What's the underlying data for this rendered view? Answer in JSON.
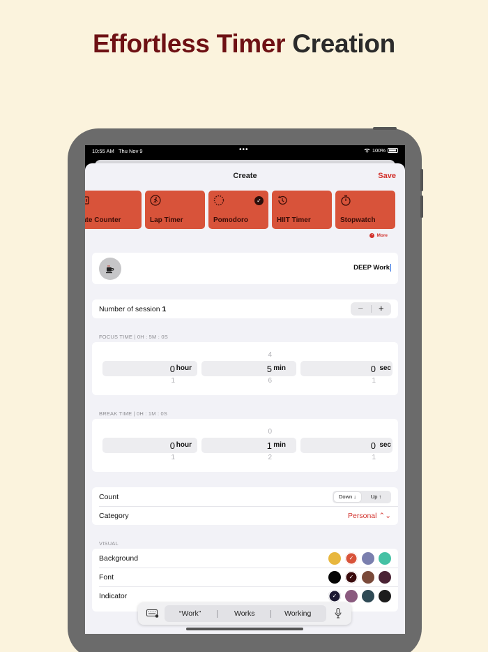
{
  "headline": {
    "part1": "Effortless Timer",
    "part2": "Creation"
  },
  "status_bar": {
    "time": "10:55 AM",
    "date": "Thu Nov 9",
    "battery": "100%"
  },
  "nav": {
    "title": "Create",
    "save_label": "Save"
  },
  "timer_types": [
    {
      "label": "ate Counter",
      "icon": "counter-icon",
      "selected": false
    },
    {
      "label": "Lap Timer",
      "icon": "running-icon",
      "selected": false
    },
    {
      "label": "Pomodoro",
      "icon": "dashed-circle-icon",
      "selected": true
    },
    {
      "label": "HIIT Timer",
      "icon": "history-icon",
      "selected": false
    },
    {
      "label": "Stopwatch",
      "icon": "stopwatch-icon",
      "selected": false
    }
  ],
  "more_label": "More",
  "timer_name": {
    "icon": "coffee-icon",
    "value": "DEEP Work"
  },
  "sessions": {
    "label": "Number of session",
    "value": "1",
    "minus": "−",
    "plus": "+"
  },
  "focus": {
    "header": "FOCUS TIME | 0H : 5M : 0S",
    "hour": {
      "value": "0",
      "unit": "hour",
      "below": "1"
    },
    "min": {
      "value": "5",
      "unit": "min",
      "above": "4",
      "below": "6"
    },
    "sec": {
      "value": "0",
      "unit": "sec",
      "below": "1"
    }
  },
  "break": {
    "header": "BREAK TIME | 0H : 1M : 0S",
    "hour": {
      "value": "0",
      "unit": "hour",
      "below": "1"
    },
    "min": {
      "value": "1",
      "unit": "min",
      "above": "0",
      "below": "2"
    },
    "sec": {
      "value": "0",
      "unit": "sec",
      "below": "1"
    }
  },
  "count": {
    "label": "Count",
    "down": "Down ↓",
    "up": "Up ↑",
    "selected": "down"
  },
  "category": {
    "label": "Category",
    "value": "Personal ⌃⌄"
  },
  "visual": {
    "header": "VISUAL",
    "background": {
      "label": "Background",
      "colors": [
        "#e8b73e",
        "#d8533a",
        "#7a7fae",
        "#45c1a4"
      ],
      "selected_index": 1
    },
    "font": {
      "label": "Font",
      "colors": [
        "#050505",
        "#3a0a0c",
        "#7a4a3a",
        "#4a2335"
      ],
      "selected_index": 1
    },
    "indicator": {
      "label": "Indicator",
      "colors": [
        "#1d1a33",
        "#8a5a7e",
        "#2f4a55",
        "#1c1c1c"
      ],
      "selected_index": 0
    }
  },
  "keyboard_suggestions": [
    "“Work”",
    "Works",
    "Working"
  ],
  "checkmark": "✓",
  "colors": {
    "accent": "#d2322d",
    "card": "#d8533a",
    "headline": "#6e1114"
  }
}
